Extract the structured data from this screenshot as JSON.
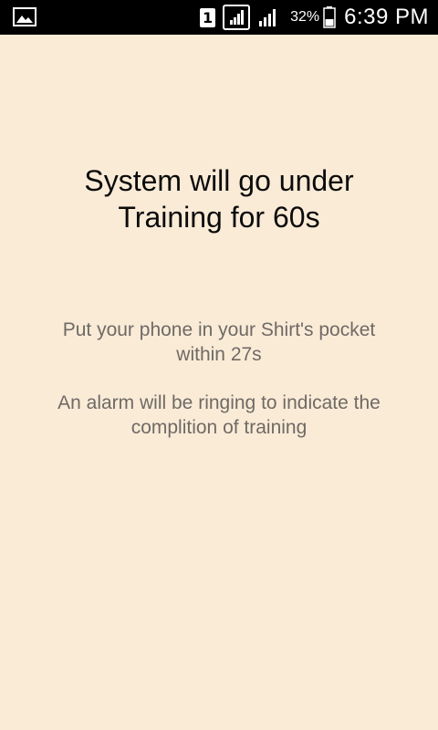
{
  "status_bar": {
    "left_icon": "image-icon",
    "sim_label": "1",
    "battery_percent": "32%",
    "battery_level": 0.32,
    "time": "6:39 PM"
  },
  "main": {
    "title_line1": "System will go under",
    "title_line2": "Training for 60s",
    "pocket_line1": "Put your phone in your Shirt's pocket",
    "pocket_line2": "within 27s",
    "alarm_line1": "An alarm will be ringing to indicate the",
    "alarm_line2": "complition of training"
  },
  "colors": {
    "background": "#faebd7",
    "status_bar": "#000000",
    "title_text": "#0b0b0b",
    "message_text": "#6f6a65"
  }
}
